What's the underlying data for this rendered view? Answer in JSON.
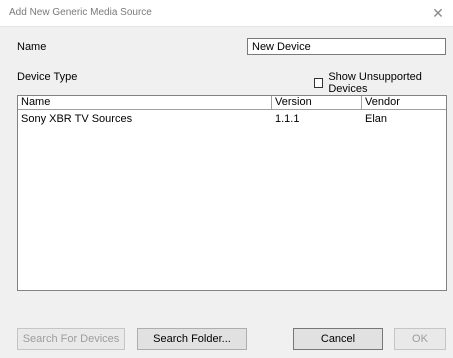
{
  "window": {
    "title": "Add New Generic Media Source",
    "close_glyph": "✕"
  },
  "form": {
    "name_label": "Name",
    "name_value": "New Device",
    "device_type_label": "Device Type",
    "show_unsupported_label": "Show Unsupported Devices",
    "show_unsupported_checked": false
  },
  "table": {
    "columns": [
      "Name",
      "Version",
      "Vendor"
    ],
    "rows": [
      {
        "name": "Sony XBR TV Sources",
        "version": "1.1.1",
        "vendor": "Elan"
      }
    ]
  },
  "buttons": {
    "search_devices": "Search For Devices",
    "search_folder": "Search Folder...",
    "cancel": "Cancel",
    "ok": "OK"
  }
}
